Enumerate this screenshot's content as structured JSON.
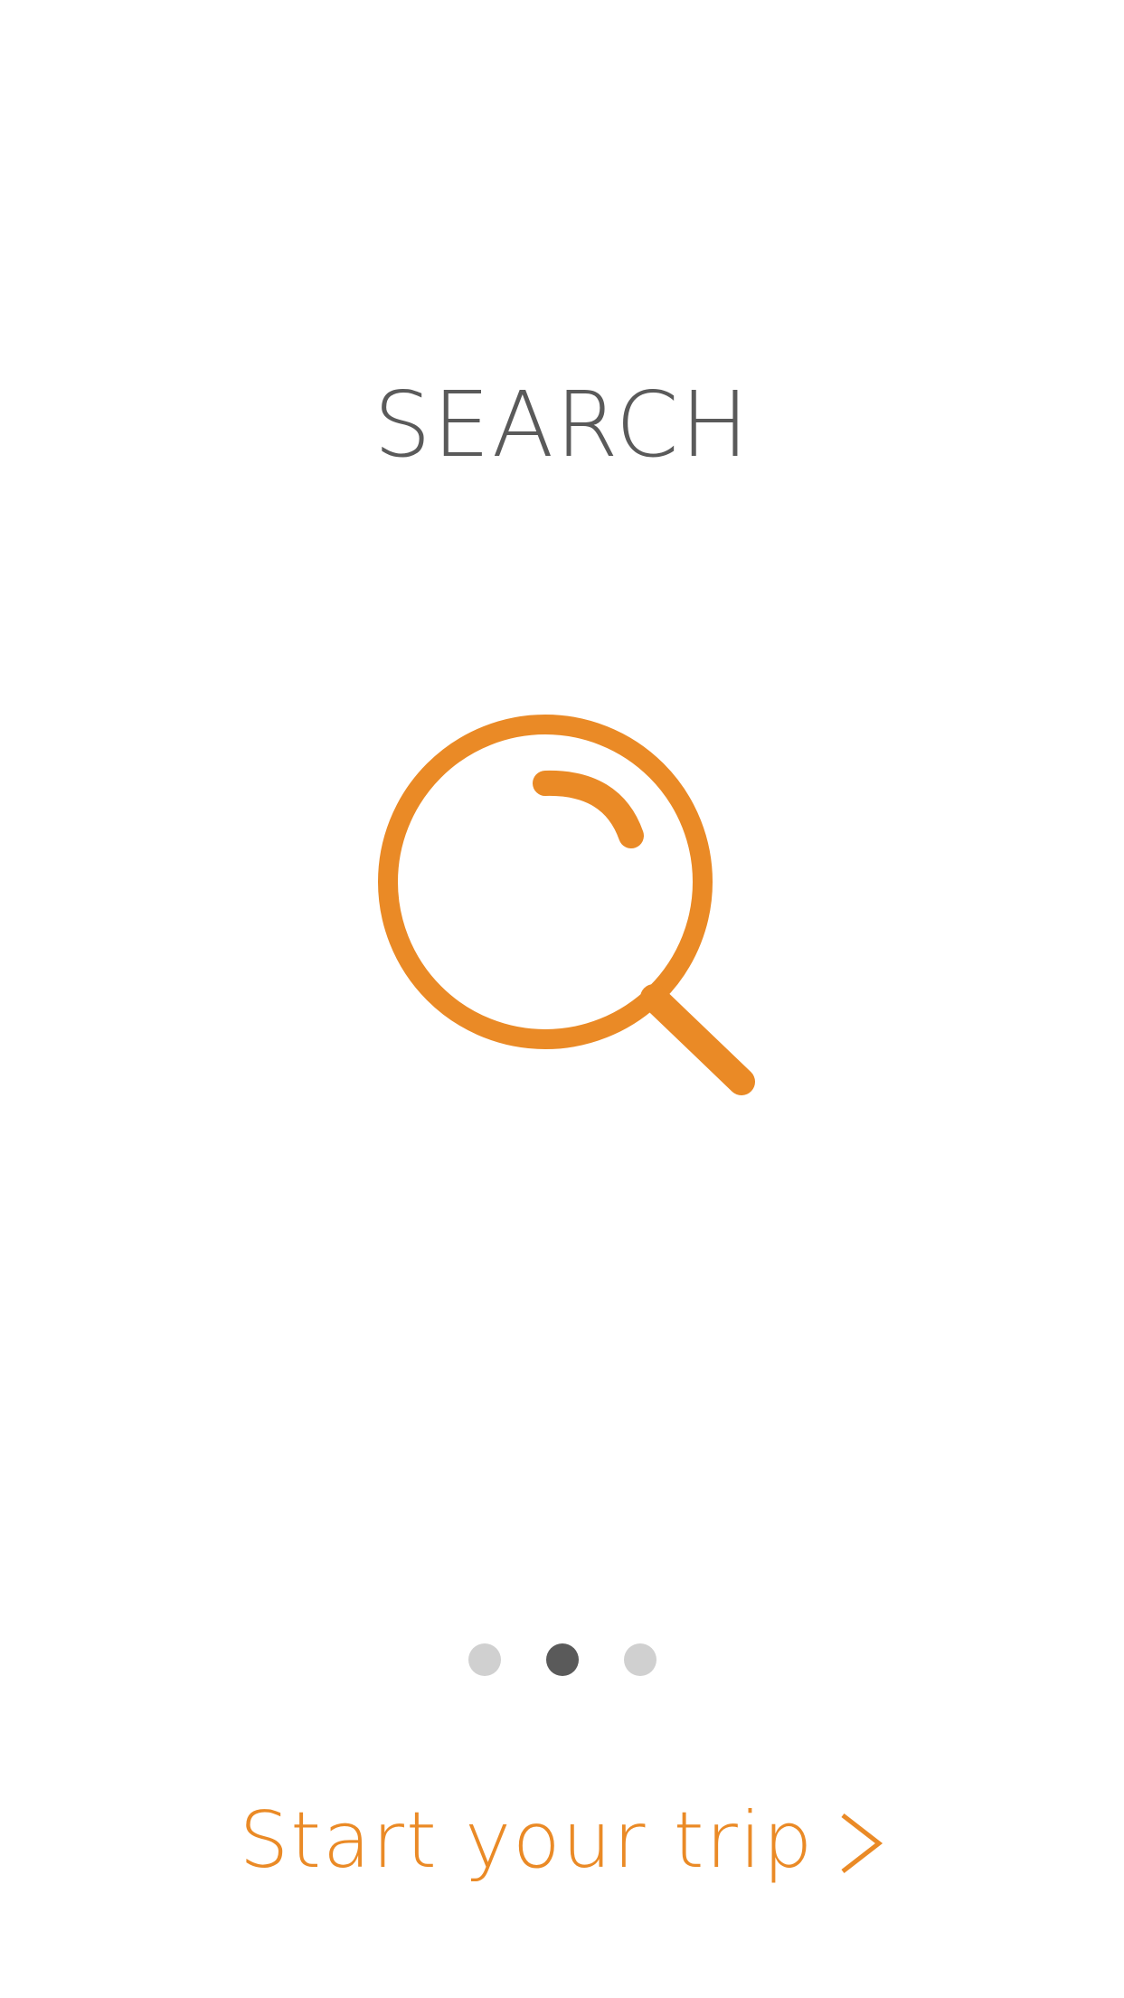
{
  "title": "SEARCH",
  "hero": {
    "icon": "search-icon"
  },
  "pager": {
    "count": 3,
    "active_index": 1
  },
  "cta": {
    "label": "Start your trip",
    "icon": "chevron-right-icon"
  },
  "colors": {
    "accent": "#EA8A26",
    "title": "#5A5A5A",
    "dot_active": "#5A5A5A",
    "dot_inactive": "#D0D0D0",
    "background": "#FFFFFF"
  }
}
